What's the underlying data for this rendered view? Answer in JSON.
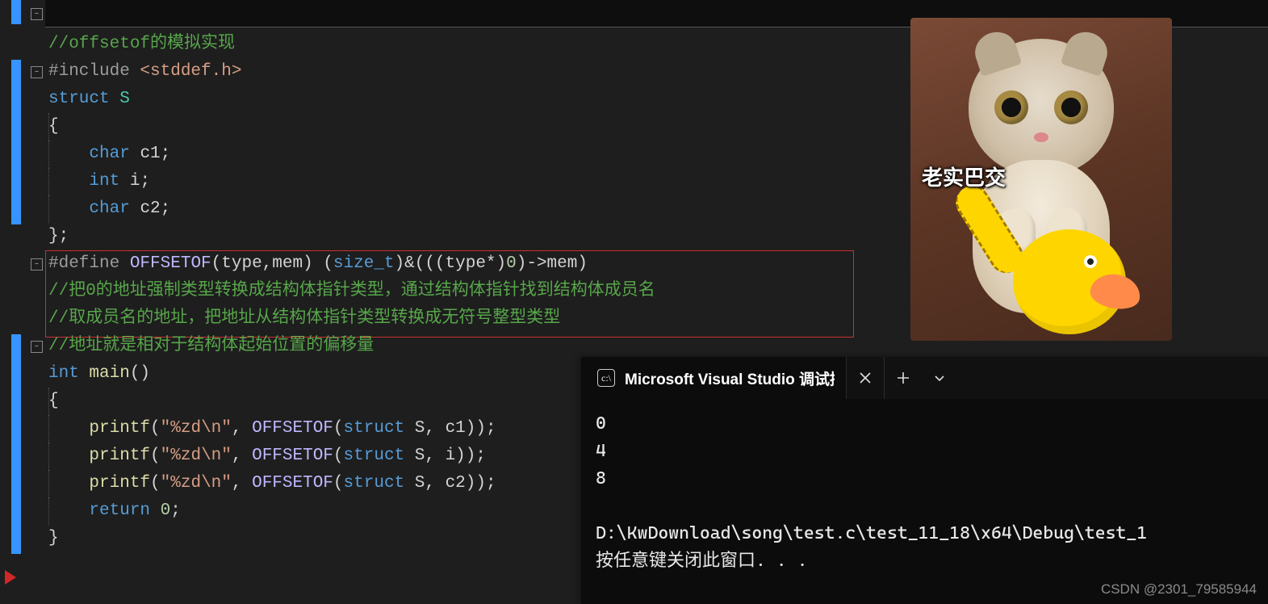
{
  "code": {
    "l1_comment": "//offsetof的模拟实现",
    "l2_directive": "#include ",
    "l2_header": "<stddef.h>",
    "l3_kw": "struct",
    "l3_name": " S",
    "l4_brace": "{",
    "l5_kw": "char",
    "l5_rest": " c1;",
    "l6_kw": "int",
    "l6_rest": " i;",
    "l7_kw": "char",
    "l7_rest": " c2;",
    "l8_brace": "};",
    "l9_directive": "#define ",
    "l9_macro": "OFFSETOF",
    "l9_paren1": "(type,mem) (",
    "l9_cast": "size_t",
    "l9_mid": ")&(((type*)",
    "l9_zero": "0",
    "l9_end": ")->mem)",
    "l10_comment": "//把0的地址强制类型转换成结构体指针类型，通过结构体指针找到结构体成员名",
    "l11_comment": "//取成员名的地址，把地址从结构体指针类型转换成无符号整型类型",
    "l12_comment": "//地址就是相对于结构体起始位置的偏移量",
    "l13_kw": "int",
    "l13_func": " main",
    "l13_paren": "()",
    "l14_brace": "{",
    "l15_call": "printf",
    "l15_p1": "(",
    "l15_str": "\"%zd\\n\"",
    "l15_comma": ", ",
    "l15_macro": "OFFSETOF",
    "l15_p2": "(",
    "l15_kw": "struct",
    "l15_arg": " S, c1));",
    "l16_call": "printf",
    "l16_p1": "(",
    "l16_str": "\"%zd\\n\"",
    "l16_comma": ", ",
    "l16_macro": "OFFSETOF",
    "l16_p2": "(",
    "l16_kw": "struct",
    "l16_arg": " S, i));",
    "l17_call": "printf",
    "l17_p1": "(",
    "l17_str": "\"%zd\\n\"",
    "l17_comma": ", ",
    "l17_macro": "OFFSETOF",
    "l17_p2": "(",
    "l17_kw": "struct",
    "l17_arg": " S, c2));",
    "l19_kw": "return",
    "l19_rest": " ",
    "l19_num": "0",
    "l19_semi": ";",
    "l20_brace": "}"
  },
  "terminal": {
    "tab_title": "Microsoft Visual Studio 调试控",
    "icon_glyph": "c:\\",
    "out1": "0",
    "out2": "4",
    "out3": "8",
    "path": "D:\\KwDownload\\song\\test.c\\test_11_18\\x64\\Debug\\test_1",
    "prompt": "按任意键关闭此窗口. . ."
  },
  "overlay": {
    "cat_caption": "老实巴交"
  },
  "watermark": "CSDN @2301_79585944"
}
